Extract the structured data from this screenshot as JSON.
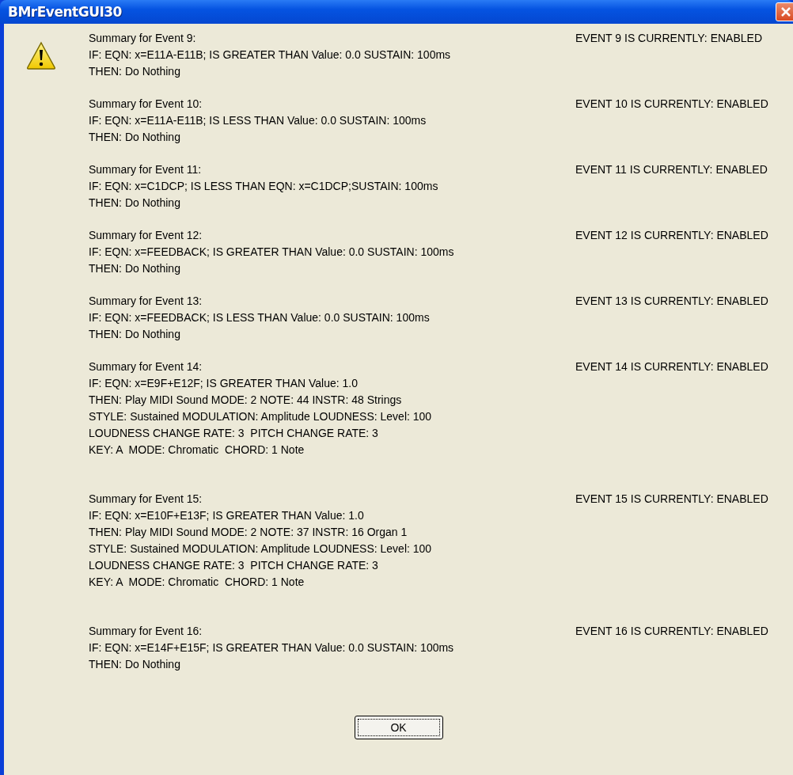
{
  "window": {
    "title": "BMrEventGUI30"
  },
  "events": [
    {
      "lines": [
        "Summary for Event 9:",
        "IF: EQN: x=E11A-E11B; IS GREATER THAN Value: 0.0 SUSTAIN: 100ms",
        "THEN: Do Nothing"
      ],
      "status": "EVENT 9 IS CURRENTLY: ENABLED"
    },
    {
      "lines": [
        "Summary for Event 10:",
        "IF: EQN: x=E11A-E11B; IS LESS THAN Value: 0.0 SUSTAIN: 100ms",
        "THEN: Do Nothing"
      ],
      "status": "EVENT 10 IS CURRENTLY: ENABLED"
    },
    {
      "lines": [
        "Summary for Event 11:",
        "IF: EQN: x=C1DCP; IS LESS THAN EQN: x=C1DCP;SUSTAIN: 100ms",
        "THEN: Do Nothing"
      ],
      "status": "EVENT 11 IS CURRENTLY: ENABLED"
    },
    {
      "lines": [
        "Summary for Event 12:",
        "IF: EQN: x=FEEDBACK; IS GREATER THAN Value: 0.0 SUSTAIN: 100ms",
        "THEN: Do Nothing"
      ],
      "status": "EVENT 12 IS CURRENTLY: ENABLED"
    },
    {
      "lines": [
        "Summary for Event 13:",
        "IF: EQN: x=FEEDBACK; IS LESS THAN Value: 0.0 SUSTAIN: 100ms",
        "THEN: Do Nothing"
      ],
      "status": "EVENT 13 IS CURRENTLY: ENABLED"
    },
    {
      "lines": [
        "Summary for Event 14:",
        "IF: EQN: x=E9F+E12F; IS GREATER THAN Value: 1.0",
        "THEN: Play MIDI Sound MODE: 2 NOTE: 44 INSTR: 48 Strings",
        "STYLE: Sustained MODULATION: Amplitude LOUDNESS: Level: 100",
        "LOUDNESS CHANGE RATE: 3  PITCH CHANGE RATE: 3",
        "KEY: A  MODE: Chromatic  CHORD: 1 Note"
      ],
      "status": "EVENT 14 IS CURRENTLY: ENABLED"
    },
    {
      "lines": [
        "Summary for Event 15:",
        "IF: EQN: x=E10F+E13F; IS GREATER THAN Value: 1.0",
        "THEN: Play MIDI Sound MODE: 2 NOTE: 37 INSTR: 16 Organ 1",
        "STYLE: Sustained MODULATION: Amplitude LOUDNESS: Level: 100",
        "LOUDNESS CHANGE RATE: 3  PITCH CHANGE RATE: 3",
        "KEY: A  MODE: Chromatic  CHORD: 1 Note"
      ],
      "status": "EVENT 15 IS CURRENTLY: ENABLED"
    },
    {
      "lines": [
        "Summary for Event 16:",
        "IF: EQN: x=E14F+E15F; IS GREATER THAN Value: 0.0 SUSTAIN: 100ms",
        "THEN: Do Nothing"
      ],
      "status": "EVENT 16 IS CURRENTLY: ENABLED"
    }
  ],
  "ok_button": "OK"
}
